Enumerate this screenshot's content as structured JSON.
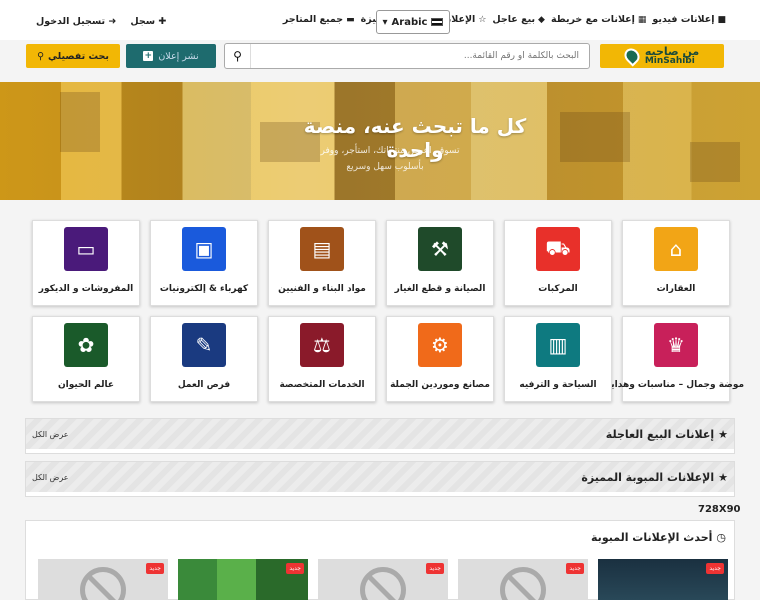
{
  "topbar": {
    "links": [
      "إعلانات فيديو",
      "إعلانات مع خريطة",
      "بيع عاجل",
      "الإعلانات المبوبة المميزة",
      "جميع المتاجر"
    ],
    "language": "Arabic",
    "register": "سجل",
    "login": "تسجيل الدخول"
  },
  "header": {
    "logo_ar": "من صاحبه",
    "logo_en": "MinSahibi",
    "search_placeholder": "البحث بالكلمة أو رقم القائمة...",
    "post_ad": "نشر إعلان",
    "advanced_search": "بحث تفصيلي"
  },
  "hero": {
    "title": "كل ما تبحث عنه، منصة واحدة",
    "subtitle": "تسوق، اعرض منتجاتك، استأجر، ووفر",
    "subtitle2": "بأسلوب سهل وسريع"
  },
  "categories": [
    {
      "label": "العقارات",
      "color": "#f2a516",
      "icon": "house-icon"
    },
    {
      "label": "المركبات",
      "color": "#e8302a",
      "icon": "car-icon"
    },
    {
      "label": "الصيانة و قطع الغيار",
      "color": "#1f4a2a",
      "icon": "tools-icon"
    },
    {
      "label": "مواد البناء و الفنيين",
      "color": "#a0521a",
      "icon": "bricks-icon"
    },
    {
      "label": "كهرباء & إلكترونيات",
      "color": "#1a5adc",
      "icon": "appliances-icon"
    },
    {
      "label": "المفروشات و الديكور",
      "color": "#4a1a7a",
      "icon": "sofa-icon"
    },
    {
      "label": "موضة وجمال – مناسبات وهدايا",
      "color": "#c8205a",
      "icon": "fashion-icon"
    },
    {
      "label": "السياحة و الترفيه",
      "color": "#0e7a80",
      "icon": "hotel-icon"
    },
    {
      "label": "مصانع وموردين الجملة",
      "color": "#f06a1a",
      "icon": "factory-icon"
    },
    {
      "label": "الخدمات المتخصصة",
      "color": "#8a1a2a",
      "icon": "services-icon"
    },
    {
      "label": "فرص العمل",
      "color": "#1a3a80",
      "icon": "job-icon"
    },
    {
      "label": "عالم الحيوان",
      "color": "#1a5a2a",
      "icon": "animals-icon"
    }
  ],
  "sections": {
    "urgent": {
      "title": "إعلانات البيع العاجلة",
      "view_all": "عرض الكل"
    },
    "featured": {
      "title": "الإعلانات المبوبة المميزة",
      "view_all": "عرض الكل"
    }
  },
  "banner": {
    "size": "728X90"
  },
  "latest": {
    "title": "أحدث الإعلانات المبوبة",
    "badge": "جديد"
  }
}
